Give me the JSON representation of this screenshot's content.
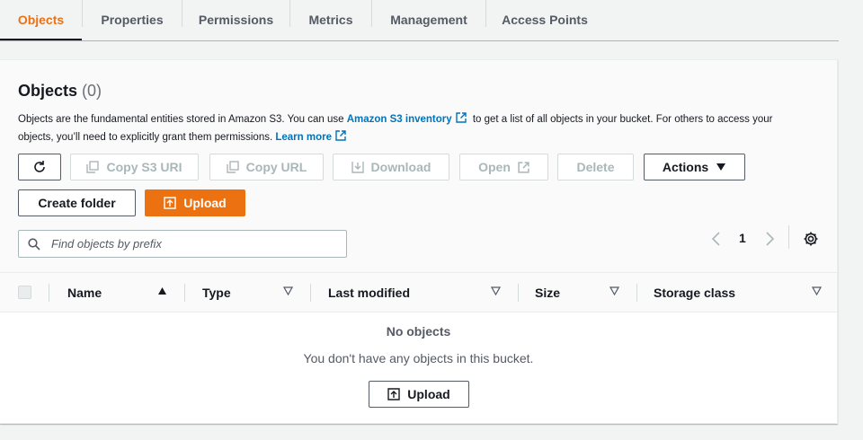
{
  "tabs": [
    {
      "label": "Objects",
      "active": true
    },
    {
      "label": "Properties"
    },
    {
      "label": "Permissions"
    },
    {
      "label": "Metrics"
    },
    {
      "label": "Management"
    },
    {
      "label": "Access Points"
    }
  ],
  "objects": {
    "title": "Objects",
    "count": "(0)",
    "desc_part1": "Objects are the fundamental entities stored in Amazon S3. You can use ",
    "inventory_link": "Amazon S3 inventory",
    "desc_part2": " to get a list of all objects in your bucket. For others to access your objects, you’ll need to explicitly grant them permissions. ",
    "learn_more": "Learn more"
  },
  "toolbar": {
    "copy_s3_uri": "Copy S3 URI",
    "copy_url": "Copy URL",
    "download": "Download",
    "open": "Open",
    "delete": "Delete",
    "actions": "Actions",
    "create_folder": "Create folder",
    "upload": "Upload"
  },
  "search": {
    "placeholder": "Find objects by prefix",
    "value": ""
  },
  "pagination": {
    "current_page": "1"
  },
  "table": {
    "columns": [
      "Name",
      "Type",
      "Last modified",
      "Size",
      "Storage class"
    ],
    "rows": []
  },
  "empty": {
    "title": "No objects",
    "text": "You don't have any objects in this bucket.",
    "upload": "Upload"
  },
  "colors": {
    "accent": "#ec7211",
    "link": "#0073bb",
    "text": "#16191f",
    "muted": "#545b64"
  },
  "icons": [
    "refresh-icon",
    "copy-icon",
    "download-icon",
    "external-link-icon",
    "caret-down-icon",
    "upload-icon",
    "search-icon",
    "chevron-left-icon",
    "chevron-right-icon",
    "gear-icon",
    "sort-ascending-icon",
    "sort-descending-icon"
  ]
}
